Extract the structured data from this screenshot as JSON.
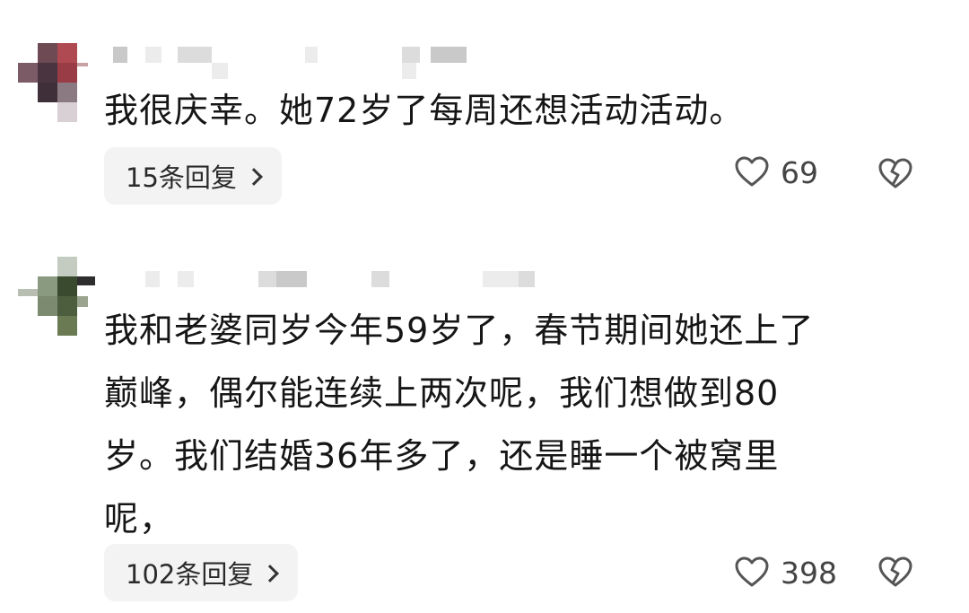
{
  "comments": [
    {
      "text": "我很庆幸。她72岁了每周还想活动活动。",
      "replies_label": "15条回复",
      "like_count": "69",
      "icons": {
        "like": "heart-outline-icon",
        "dislike": "broken-heart-icon",
        "chevron": "chevron-right-icon"
      }
    },
    {
      "text": "我和老婆同岁今年59岁了，春节期间她还上了\n巅峰，偶尔能连续上两次呢，我们想做到80\n岁。我们结婚36年多了，还是睡一个被窝里\n呢，",
      "replies_label": "102条回复",
      "like_count": "398",
      "icons": {
        "like": "heart-outline-icon",
        "dislike": "broken-heart-icon",
        "chevron": "chevron-right-icon"
      }
    }
  ],
  "colors": {
    "text": "#161616",
    "reply_bg": "#f3f3f3",
    "icon": "#555555"
  }
}
